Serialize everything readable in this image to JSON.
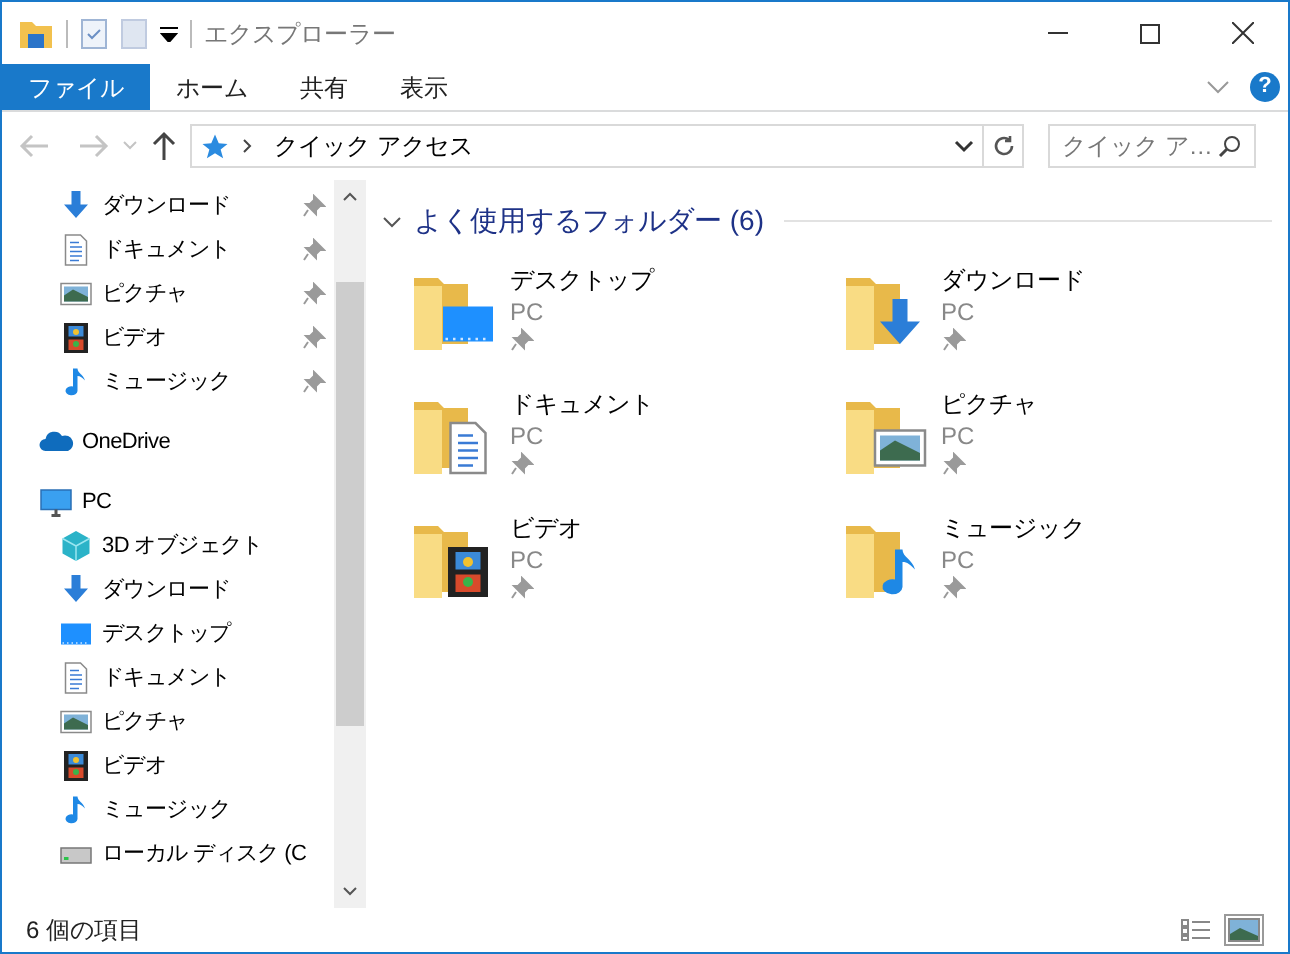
{
  "window": {
    "title": "エクスプローラー"
  },
  "ribbon_tabs": [
    {
      "label": "ファイル",
      "selected": true
    },
    {
      "label": "ホーム",
      "selected": false
    },
    {
      "label": "共有",
      "selected": false
    },
    {
      "label": "表示",
      "selected": false
    }
  ],
  "help_button": {
    "label": "?"
  },
  "address_bar": {
    "path": "クイック アクセス"
  },
  "search": {
    "placeholder": "クイック ア…"
  },
  "navigation": {
    "quick_access": [
      {
        "label": "ダウンロード",
        "kind": "downloads",
        "pinned": true
      },
      {
        "label": "ドキュメント",
        "kind": "documents",
        "pinned": true
      },
      {
        "label": "ピクチャ",
        "kind": "pictures",
        "pinned": true
      },
      {
        "label": "ビデオ",
        "kind": "videos",
        "pinned": true
      },
      {
        "label": "ミュージック",
        "kind": "music",
        "pinned": true
      }
    ],
    "locations": [
      {
        "label": "OneDrive",
        "kind": "onedrive"
      },
      {
        "label": "PC",
        "kind": "pc",
        "children": [
          {
            "label": "3D オブジェクト",
            "kind": "objects3d"
          },
          {
            "label": "ダウンロード",
            "kind": "downloads"
          },
          {
            "label": "デスクトップ",
            "kind": "desktop"
          },
          {
            "label": "ドキュメント",
            "kind": "documents"
          },
          {
            "label": "ピクチャ",
            "kind": "pictures"
          },
          {
            "label": "ビデオ",
            "kind": "videos"
          },
          {
            "label": "ミュージック",
            "kind": "music"
          },
          {
            "label": "ローカル ディスク (C",
            "kind": "disk"
          }
        ]
      }
    ]
  },
  "frequent_folders": {
    "title": "よく使用するフォルダー (6)",
    "expanded": true,
    "folders": [
      {
        "name": "デスクトップ",
        "location": "PC",
        "kind": "desktop",
        "pinned": true
      },
      {
        "name": "ダウンロード",
        "location": "PC",
        "kind": "downloads",
        "pinned": true
      },
      {
        "name": "ドキュメント",
        "location": "PC",
        "kind": "documents",
        "pinned": true
      },
      {
        "name": "ピクチャ",
        "location": "PC",
        "kind": "pictures",
        "pinned": true
      },
      {
        "name": "ビデオ",
        "location": "PC",
        "kind": "videos",
        "pinned": true
      },
      {
        "name": "ミュージック",
        "location": "PC",
        "kind": "music",
        "pinned": true
      }
    ]
  },
  "status_bar": {
    "item_count": "6 個の項目",
    "views": [
      {
        "kind": "details",
        "selected": false
      },
      {
        "kind": "large_icons",
        "selected": true
      }
    ]
  }
}
